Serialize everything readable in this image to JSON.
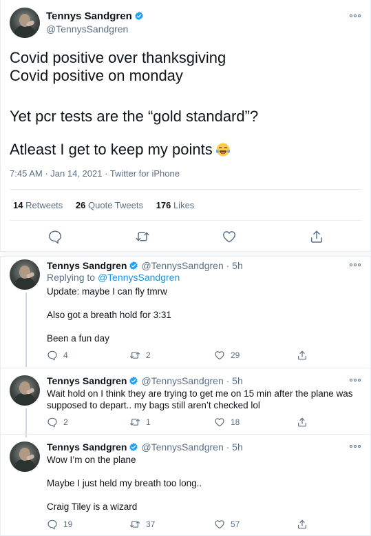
{
  "main_tweet": {
    "author_name": "Tennys Sandgren",
    "author_handle": "@TennysSandgren",
    "lines": [
      "Covid positive over thanksgiving",
      "Covid positive on monday",
      "Yet pcr tests are the “gold standard”?",
      "Atleast I get to keep my points"
    ],
    "emoji_icon": "face-with-tears-of-joy-emoji",
    "time": "7:45 AM",
    "date": "Jan 14, 2021",
    "source": "Twitter for iPhone",
    "stats": {
      "retweets_count": "14",
      "retweets_label": "Retweets",
      "quotes_count": "26",
      "quotes_label": "Quote Tweets",
      "likes_count": "176",
      "likes_label": "Likes"
    },
    "actions": [
      "reply-icon",
      "retweet-icon",
      "like-icon",
      "share-icon"
    ]
  },
  "replies": [
    {
      "author_name": "Tennys Sandgren",
      "author_handle": "@TennysSandgren · 5h",
      "replying_prefix": "Replying to",
      "replying_to": "@TennysSandgren",
      "lines": [
        "Update: maybe I can fly tmrw",
        "Also got a breath hold for 3:31",
        "Been a fun day"
      ],
      "reply_count": "4",
      "retweet_count": "2",
      "like_count": "29"
    },
    {
      "author_name": "Tennys Sandgren",
      "author_handle": "@TennysSandgren · 5h",
      "lines": [
        "Wait hold on I think they are trying to get me on 15 min after the plane was",
        "supposed to depart.. my bags still aren’t checked lol"
      ],
      "reply_count": "2",
      "retweet_count": "1",
      "like_count": "18"
    },
    {
      "author_name": "Tennys Sandgren",
      "author_handle": "@TennysSandgren · 5h",
      "lines": [
        "Wow I’m on the plane",
        "Maybe I just held my breath too long..",
        "Craig Tiley is a wizard"
      ],
      "reply_count": "19",
      "retweet_count": "37",
      "like_count": "57"
    }
  ],
  "colors": {
    "text": "#0f1419",
    "secondary": "#5b7083",
    "link": "#1b95e0",
    "verified": "#1da1f2",
    "divider": "#e6ecf0"
  }
}
